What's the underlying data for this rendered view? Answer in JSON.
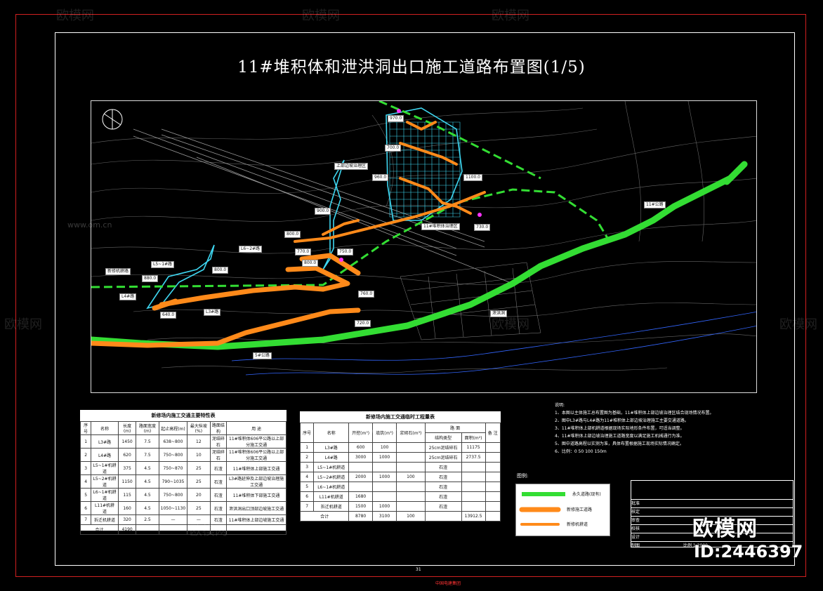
{
  "title": "11#堆积体和泄洪洞出口施工道路布置图(1/5)",
  "map_labels": {
    "zone_upper": "上部边坡治理区",
    "zone_11": "11#堆积体治理区",
    "road_l3": "L3#路",
    "road_l4": "L4#路",
    "road_l5": "L5~1#路",
    "road_l6": "L6~2#路",
    "road_new": "新修机耕路",
    "road_existing": "5#公路",
    "road_2": "11#公路",
    "tunnel": "泄洪洞",
    "pt_top": "1100.0",
    "elev": [
      "960.0",
      "970.0",
      "900.0",
      "800.0",
      "770.0",
      "750.0",
      "720.0",
      "760.0",
      "880.0",
      "800.0",
      "640.0",
      "730.0",
      "700.0",
      "800.0"
    ]
  },
  "table1": {
    "caption": "新修场内施工交通主要特性表",
    "headers": [
      "序号",
      "名称",
      "长度(m)",
      "路面宽度(m)",
      "起止高程(m)",
      "最大纵坡(%)",
      "路面结构",
      "用 途"
    ],
    "rows": [
      [
        "1",
        "L3#路",
        "1450",
        "7.5",
        "638~800",
        "12",
        "泥结碎石",
        "11#堆积体606平公路以上部分施工交通"
      ],
      [
        "2",
        "L4#路",
        "620",
        "7.5",
        "750~800",
        "10",
        "泥结碎石",
        "11#堆积体606平公路以上部分施工交通"
      ],
      [
        "3",
        "L5~1#机耕道",
        "375",
        "4.5",
        "750~870",
        "25",
        "石渣",
        "11#堆积体上部施工交通"
      ],
      [
        "4",
        "L5~2#机耕道",
        "1150",
        "4.5",
        "790~1035",
        "25",
        "石渣",
        "L3#路延伸及上部边坡治理施工交通"
      ],
      [
        "5",
        "L6~1#机耕道",
        "115",
        "4.5",
        "750~800",
        "20",
        "石渣",
        "11#堆积体下部施工交通"
      ],
      [
        "6",
        "L11#机耕道",
        "160",
        "4.5",
        "1050~1130",
        "25",
        "石渣",
        "泄洪洞出口顶部边坡施工交通"
      ],
      [
        "7",
        "拆迁机耕道",
        "320",
        "2.5",
        "—",
        "—",
        "石渣",
        "11#堆积体上部边坡施工交通"
      ]
    ],
    "total_label": "合计",
    "total_length": "4190"
  },
  "table2": {
    "caption": "新修场内施工交通临时工程量表",
    "headers": [
      "序号",
      "名称",
      "开挖(m³)",
      "填筑(m³)",
      "浆砌石(m³)",
      "结构类型",
      "面积(m²)",
      "备 注"
    ],
    "group_header": "路 面",
    "rows": [
      [
        "1",
        "L3#路",
        "600",
        "100",
        "",
        "25cm泥结碎石",
        "11175",
        ""
      ],
      [
        "2",
        "L4#路",
        "3000",
        "1000",
        "",
        "25cm泥结碎石",
        "2737.5",
        ""
      ],
      [
        "3",
        "L5~1#机耕道",
        "",
        "",
        "",
        "石渣",
        "",
        ""
      ],
      [
        "4",
        "L5~2#机耕道",
        "2000",
        "1000",
        "100",
        "石渣",
        "",
        ""
      ],
      [
        "5",
        "L6~1#机耕道",
        "",
        "",
        "",
        "石渣",
        "",
        ""
      ],
      [
        "6",
        "L11#机耕道",
        "1680",
        "",
        "",
        "石渣",
        "",
        ""
      ],
      [
        "7",
        "拆迁机耕道",
        "1500",
        "1000",
        "",
        "石渣",
        "",
        ""
      ]
    ],
    "total_label": "合计",
    "totals": [
      "8780",
      "3100",
      "100",
      "",
      "13912.5",
      ""
    ]
  },
  "notes": {
    "heading": "说明:",
    "items": [
      "1、本图以主体施工总布置图为基础，11#堆积体上部边坡治理区结合现场情况布置。",
      "2、图中L3#路与L4#路为11#堆积体上部边坡治理施工主要交通道路。",
      "3、11#堆积体上部机耕道根据现场实际地形条件布置，可适当调整。",
      "4、11#堆积体上部边坡治理施工道路宽度以满足施工机械通行为准。",
      "5、图中道路高程以实测为准，具体布置根据施工现场实际情况确定。",
      "6、比例：0  50  100  150m"
    ]
  },
  "legend": {
    "title": "图例:",
    "items": [
      {
        "label": "永久道路(现有)",
        "color": "#33dd33"
      },
      {
        "label": "新修施工道路",
        "color": "#ff8a1a"
      },
      {
        "label": "新修机耕道",
        "color": "#ff8a1a"
      }
    ]
  },
  "titleblock": {
    "rows": [
      "批准",
      "核定",
      "审查",
      "校核",
      "设计",
      "制图"
    ],
    "scale": "比例 1:2000"
  },
  "watermark": {
    "brand": "欧模网",
    "site": "www.om.cn",
    "id": "ID:2446397"
  },
  "sheet_no": "31",
  "footer_red": "中国电建集团"
}
